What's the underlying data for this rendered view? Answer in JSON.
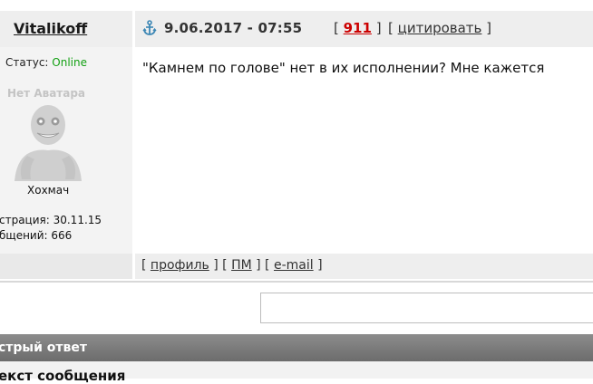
{
  "post": {
    "author": "Vitalikoff",
    "date": "9.06.2017 - 07:55",
    "number": "911",
    "quote_label": "цитировать",
    "message": "\"Камнем по голове\" нет в их исполнении? Мне кажется"
  },
  "author_panel": {
    "status_label": "Статус:",
    "status_value": "Online",
    "status_color": "#13a013",
    "no_avatar": "Нет Аватара",
    "nickname": "Хохмач",
    "registration": "страция: 30.11.15",
    "posts": "бщений: 666"
  },
  "footer_links": {
    "profile": "профиль",
    "pm": "ПМ",
    "email": "e-mail"
  },
  "quick_reply": {
    "title": "стрый ответ",
    "subtitle": "екст сообщения"
  },
  "icons": [
    "anchor-icon",
    "avatar-placeholder"
  ]
}
